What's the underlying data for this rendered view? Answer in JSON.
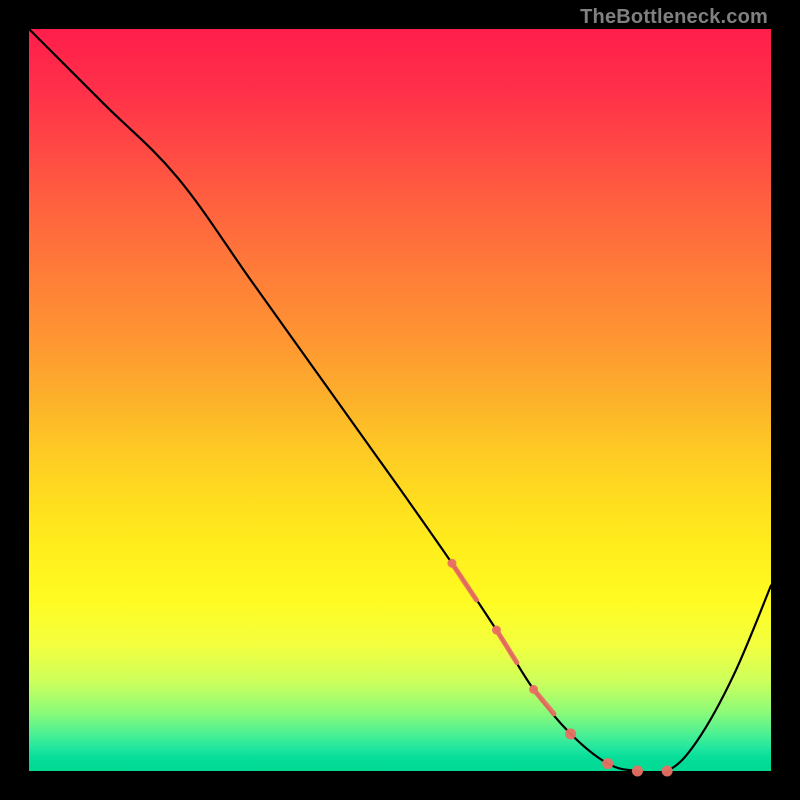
{
  "watermark": "TheBottleneck.com",
  "colors": {
    "curve": "#000000",
    "marker": "#e97063"
  },
  "chart_data": {
    "type": "line",
    "title": "",
    "xlabel": "",
    "ylabel": "",
    "xlim": [
      0,
      100
    ],
    "ylim": [
      0,
      100
    ],
    "grid": false,
    "series": [
      {
        "name": "bottleneck-curve",
        "x": [
          0,
          10,
          20,
          30,
          40,
          50,
          57,
          63,
          68,
          73,
          78,
          82,
          86,
          90,
          95,
          100
        ],
        "y": [
          100,
          90,
          80,
          66,
          52,
          38,
          28,
          19,
          11,
          5,
          1,
          0,
          0,
          4,
          13,
          25
        ]
      }
    ],
    "highlight": {
      "name": "marker-segment",
      "x": [
        57,
        63,
        68,
        73,
        78,
        82,
        86
      ],
      "y": [
        28,
        19,
        11,
        5,
        1,
        0,
        0
      ]
    }
  }
}
